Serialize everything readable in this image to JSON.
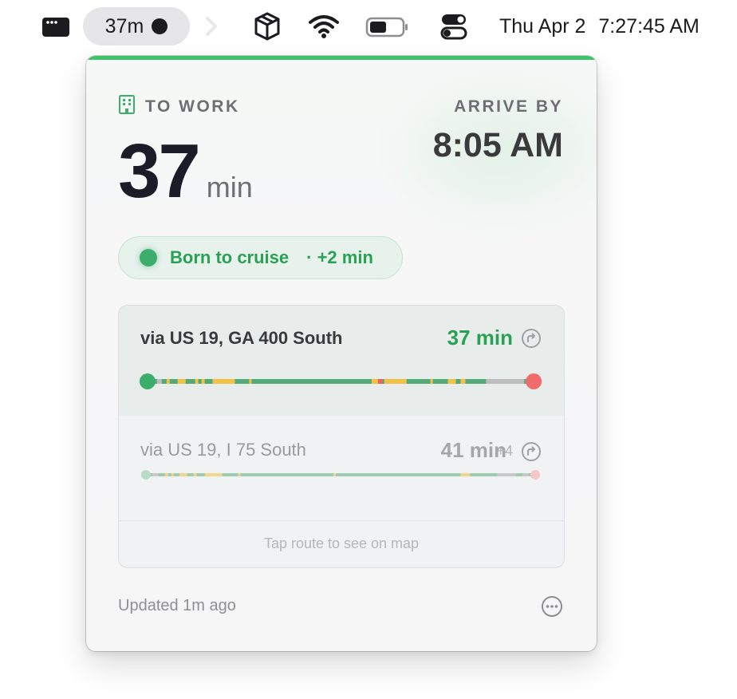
{
  "menubar": {
    "app_icon": "terminal-window-icon",
    "commute_pill": {
      "text": "37m",
      "icon": "recording-dot-icon"
    },
    "status_icons": [
      "chevron-right-icon",
      "cube-icon",
      "wifi-icon",
      "battery-icon",
      "control-center-icon"
    ],
    "clock": {
      "date": "Thu Apr 2",
      "time": "7:27:45 AM"
    }
  },
  "panel": {
    "accent_color": "#3cc36c",
    "destination": {
      "icon": "building-icon",
      "label": "TO WORK"
    },
    "eta": {
      "value": "37",
      "unit": "min"
    },
    "arrive": {
      "label": "ARRIVE BY",
      "time": "8:05 AM"
    },
    "status": {
      "text": "Born to cruise",
      "extra": "· +2 min",
      "color": "#2aa152"
    },
    "routes": [
      {
        "name": "via US 19, GA 400 South",
        "time": "37 min",
        "delta": "",
        "selected": true,
        "icon": "route-arrow-icon"
      },
      {
        "name": "via US 19, I 75 South",
        "time": "41 min",
        "delta": "+4",
        "selected": false,
        "icon": "route-arrow-icon"
      }
    ],
    "hint": "Tap route to see on map",
    "updated": "Updated 1m ago",
    "more_icon": "ellipsis-circle-icon"
  }
}
